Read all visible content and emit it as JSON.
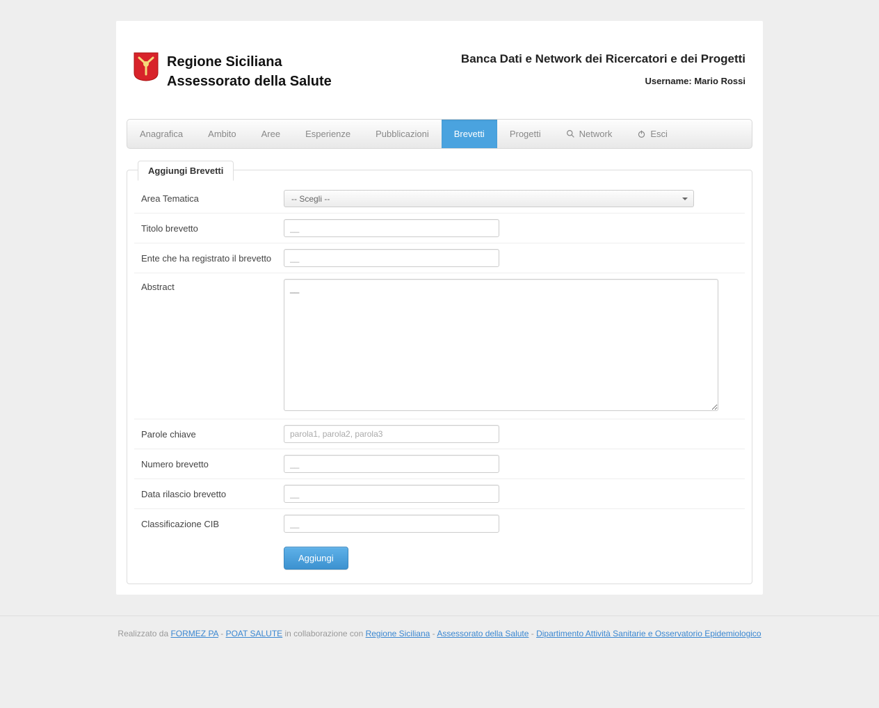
{
  "header": {
    "org_line1": "Regione Siciliana",
    "org_line2": "Assessorato della Salute",
    "app_title": "Banca Dati e Network dei Ricercatori e dei Progetti",
    "username_label": "Username:",
    "username": "Mario Rossi"
  },
  "nav": {
    "items": [
      {
        "label": "Anagrafica",
        "icon": null
      },
      {
        "label": "Ambito",
        "icon": null
      },
      {
        "label": "Aree",
        "icon": null
      },
      {
        "label": "Esperienze",
        "icon": null
      },
      {
        "label": "Pubblicazioni",
        "icon": null
      },
      {
        "label": "Brevetti",
        "icon": null,
        "active": true
      },
      {
        "label": "Progetti",
        "icon": null
      },
      {
        "label": "Network",
        "icon": "search"
      },
      {
        "label": "Esci",
        "icon": "power"
      }
    ]
  },
  "form": {
    "legend": "Aggiungi Brevetti",
    "fields": {
      "area_tematica": {
        "label": "Area Tematica",
        "selected": "-- Scegli --"
      },
      "titolo": {
        "label": "Titolo brevetto",
        "placeholder": "__",
        "value": ""
      },
      "ente": {
        "label": "Ente che ha registrato il brevetto",
        "placeholder": "__",
        "value": ""
      },
      "abstract": {
        "label": "Abstract",
        "placeholder": "__",
        "value": ""
      },
      "parole_chiave": {
        "label": "Parole chiave",
        "placeholder": "parola1, parola2, parola3",
        "value": ""
      },
      "numero": {
        "label": "Numero brevetto",
        "placeholder": "__",
        "value": ""
      },
      "data_rilascio": {
        "label": "Data rilascio brevetto",
        "placeholder": "__",
        "value": ""
      },
      "classificazione": {
        "label": "Classificazione CIB",
        "placeholder": "__",
        "value": ""
      }
    },
    "submit_label": "Aggiungi"
  },
  "footer": {
    "prefix": "Realizzato da ",
    "link1": "FORMEZ PA",
    "sep1": " - ",
    "link2": "POAT SALUTE",
    "mid": " in collaborazione con ",
    "link3": "Regione Siciliana",
    "sep2": " - ",
    "link4": "Assessorato della Salute",
    "sep3": " - ",
    "link5": "Dipartimento Attività Sanitarie e Osservatorio Epidemiologico"
  }
}
